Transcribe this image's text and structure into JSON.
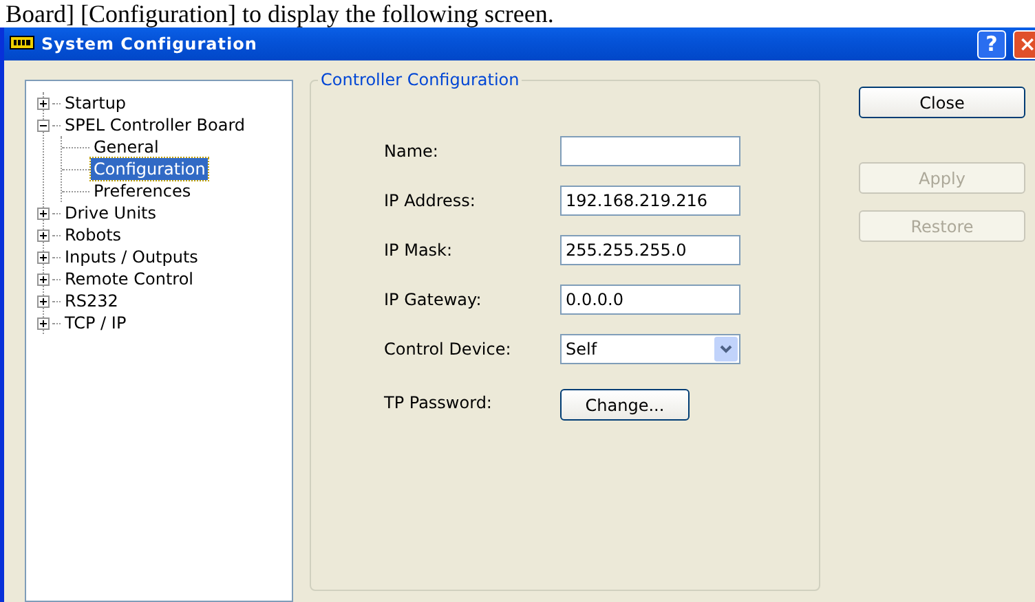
{
  "caption": "Board] [Configuration] to display the following screen.",
  "window": {
    "title": "System Configuration",
    "help_button": "?",
    "close_button": "×"
  },
  "tree": [
    {
      "label": "Startup",
      "expanded": false,
      "selected": false
    },
    {
      "label": "SPEL Controller Board",
      "expanded": true,
      "selected": false,
      "children": [
        {
          "label": "General",
          "selected": false
        },
        {
          "label": "Configuration",
          "selected": true
        },
        {
          "label": "Preferences",
          "selected": false
        }
      ]
    },
    {
      "label": "Drive Units",
      "expanded": false,
      "selected": false
    },
    {
      "label": "Robots",
      "expanded": false,
      "selected": false
    },
    {
      "label": "Inputs / Outputs",
      "expanded": false,
      "selected": false
    },
    {
      "label": "Remote Control",
      "expanded": false,
      "selected": false
    },
    {
      "label": "RS232",
      "expanded": false,
      "selected": false
    },
    {
      "label": "TCP / IP",
      "expanded": false,
      "selected": false
    }
  ],
  "group": {
    "title": "Controller Configuration",
    "fields": [
      {
        "kind": "text",
        "label": "Name:"
      },
      {
        "kind": "text",
        "label": "IP Address:",
        "value": "192.168.219.216"
      },
      {
        "kind": "text",
        "label": "IP Mask:",
        "value": "255.255.255.0"
      },
      {
        "kind": "text",
        "label": "IP Gateway:",
        "value": "0.0.0.0"
      },
      {
        "kind": "dropdown",
        "label": "Control Device:",
        "value": "Self"
      },
      {
        "kind": "button",
        "label": "TP Password:",
        "button": "Change..."
      }
    ]
  },
  "buttons": [
    {
      "label": "Close",
      "disabled": false
    },
    {
      "label": "Apply",
      "disabled": true
    },
    {
      "label": "Restore",
      "disabled": true
    }
  ]
}
